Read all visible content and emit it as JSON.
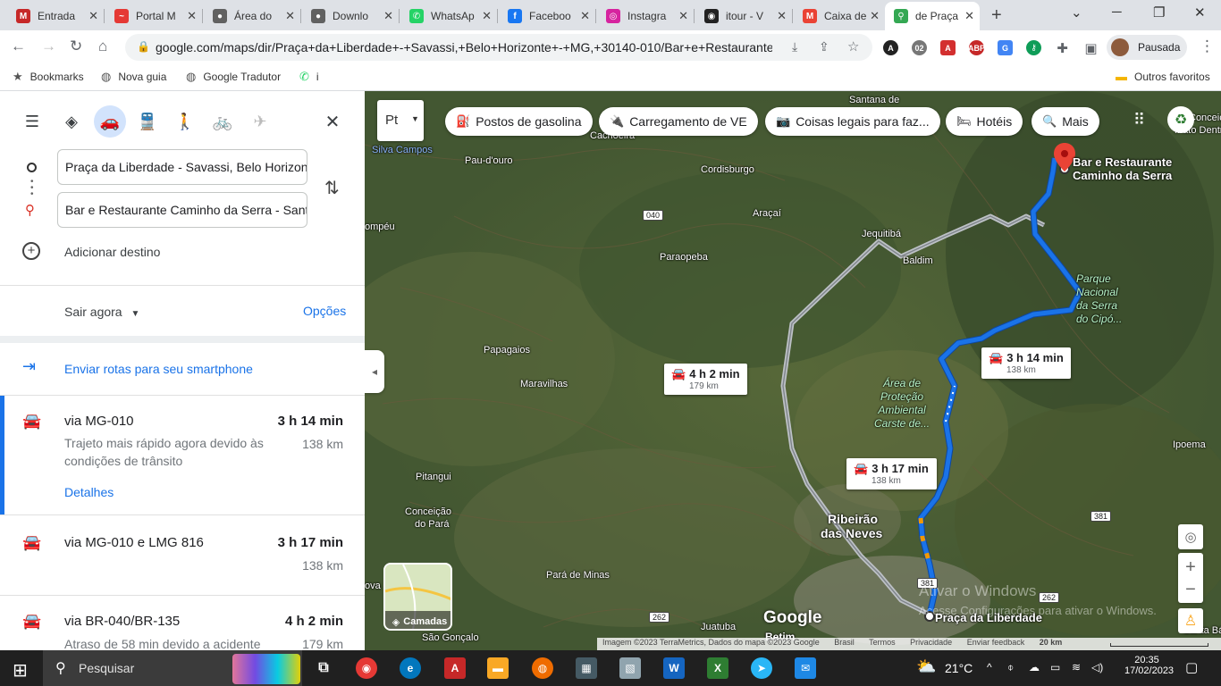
{
  "tabs": [
    {
      "title": "Entrada",
      "color": "#c62828",
      "glyph": "M"
    },
    {
      "title": "Portal M",
      "color": "#e53935",
      "glyph": "~"
    },
    {
      "title": "Área do",
      "color": "#616161",
      "glyph": "●"
    },
    {
      "title": "Downlo",
      "color": "#616161",
      "glyph": "●"
    },
    {
      "title": "WhatsAp",
      "color": "#25d366",
      "glyph": "✆"
    },
    {
      "title": "Faceboo",
      "color": "#1877f2",
      "glyph": "f"
    },
    {
      "title": "Instagra",
      "color": "#d6249f",
      "glyph": "◎"
    },
    {
      "title": "itour - V",
      "color": "#222222",
      "glyph": "◉"
    },
    {
      "title": "Caixa de",
      "color": "#ea4335",
      "glyph": "M"
    },
    {
      "title": "de Praça",
      "color": "#34a853",
      "glyph": "⚲"
    }
  ],
  "address": {
    "url": "google.com/maps/dir/Praça+da+Liberdade+-+Savassi,+Belo+Horizonte+-+MG,+30140-010/Bar+e+Restaurante..."
  },
  "profile": {
    "label": "Pausada"
  },
  "bookmarks": [
    {
      "label": "Bookmarks",
      "icon": "star-icon"
    },
    {
      "label": "Nova guia",
      "icon": "globe-icon"
    },
    {
      "label": "Google Tradutor",
      "icon": "globe-icon"
    },
    {
      "label": "i",
      "icon": "whatsapp-icon"
    }
  ],
  "other_bookmarks": "Outros favoritos",
  "directions": {
    "origin": "Praça da Liberdade - Savassi, Belo Horizonte",
    "destination": "Bar e Restaurante Caminho da Serra - Santana",
    "add_destination": "Adicionar destino",
    "depart": "Sair agora",
    "options": "Opções",
    "send_to_phone": "Enviar rotas para seu smartphone",
    "routes": [
      {
        "via": "via MG-010",
        "time": "3 h 14 min",
        "km": "138 km",
        "desc": "Trajeto mais rápido agora devido às condições de trânsito",
        "details": "Detalhes"
      },
      {
        "via": "via MG-010 e LMG 816",
        "time": "3 h 17 min",
        "km": "138 km"
      },
      {
        "via": "via BR-040/BR-135",
        "time": "4 h 2 min",
        "km": "179 km",
        "desc": "Atraso de 58 min devido a acidente"
      }
    ]
  },
  "map": {
    "layer_label": "Pt",
    "chips": [
      {
        "label": "Postos de gasolina",
        "icon": "fuel-icon"
      },
      {
        "label": "Carregamento de VE",
        "icon": "ev-icon"
      },
      {
        "label": "Coisas legais para faz...",
        "icon": "camera-icon"
      },
      {
        "label": "Hotéis",
        "icon": "bed-icon"
      },
      {
        "label": "Mais",
        "icon": "search-icon"
      }
    ],
    "places": [
      {
        "name": "Santana de",
        "cls": ""
      },
      {
        "name": "Silva Campos",
        "cls": "blue"
      },
      {
        "name": "Cachoeira",
        "cls": ""
      },
      {
        "name": "Pau-d'ouro",
        "cls": ""
      },
      {
        "name": "Cordisburgo",
        "cls": ""
      },
      {
        "name": "Araçaí",
        "cls": ""
      },
      {
        "name": "Jequitibá",
        "cls": ""
      },
      {
        "name": "Baldim",
        "cls": ""
      },
      {
        "name": "Paraopeba",
        "cls": ""
      },
      {
        "name": "ompéu",
        "cls": ""
      },
      {
        "name": "Papagaios",
        "cls": ""
      },
      {
        "name": "Maravilhas",
        "cls": ""
      },
      {
        "name": "Pitangui",
        "cls": ""
      },
      {
        "name": "Conceição",
        "cls": ""
      },
      {
        "name": "do Pará",
        "cls": ""
      },
      {
        "name": "Pará de Minas",
        "cls": ""
      },
      {
        "name": "ova",
        "cls": ""
      },
      {
        "name": "Juatuba",
        "cls": ""
      },
      {
        "name": "São Gonçalo",
        "cls": ""
      },
      {
        "name": "Ipoema",
        "cls": ""
      },
      {
        "name": "Santa Bárb",
        "cls": ""
      },
      {
        "name": "Betim",
        "cls": ""
      },
      {
        "name": "Conceição do",
        "cls": ""
      },
      {
        "name": "Mato Dentro",
        "cls": ""
      }
    ],
    "big_places": [
      "Ribeirão",
      "das Neves",
      "Praça da Liberdade"
    ],
    "park": [
      "Parque",
      "Nacional",
      "da Serra",
      "do Cipó..."
    ],
    "protection": [
      "Área de",
      "Proteção",
      "Ambiental",
      "Carste de..."
    ],
    "destination_label": [
      "Bar e Restaurante",
      "Caminho da Serra"
    ],
    "bubbles": [
      {
        "time": "3 h 14 min",
        "km": "138 km"
      },
      {
        "time": "4 h 2 min",
        "km": "179 km"
      },
      {
        "time": "3 h 17 min",
        "km": "138 km"
      }
    ],
    "shields": [
      "040",
      "381",
      "381",
      "262",
      "262"
    ],
    "layers_label": "Camadas",
    "logo": "Google",
    "watermark": [
      "Ativar o Windows",
      "Acesse Configurações para ativar o Windows."
    ],
    "footer": [
      "Imagem ©2023 TerraMetrics, Dados do mapa ©2023 Google",
      "Brasil",
      "Termos",
      "Privacidade",
      "Enviar feedback",
      "20 km"
    ]
  },
  "taskbar": {
    "search_placeholder": "Pesquisar",
    "weather": "21°C",
    "time": "20:35",
    "date": "17/02/2023"
  },
  "colors": {
    "route_primary": "#1a73e8",
    "route_alt": "#9aa0a6",
    "active_route_bar": "#1a73e8",
    "map_bg": "#4a5e34"
  }
}
